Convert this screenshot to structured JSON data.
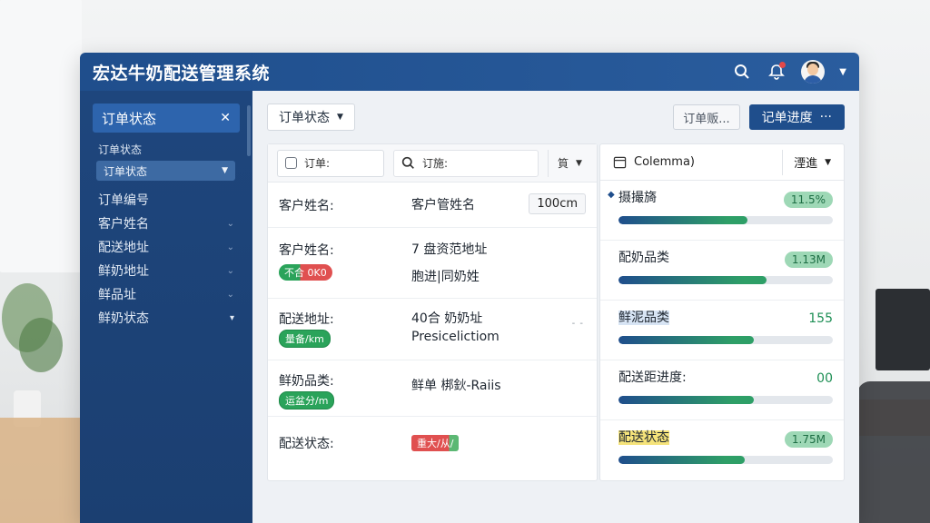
{
  "app": {
    "title": "宏达牛奶配送管理系统"
  },
  "sidebar": {
    "header_label": "订单状态",
    "sub_label": "订单状态",
    "select_value": "订单状态",
    "items": [
      {
        "label": "订单编号"
      },
      {
        "label": "客户姓名"
      },
      {
        "label": "配送地址"
      },
      {
        "label": "鲜奶地址"
      },
      {
        "label": "鲜品址"
      },
      {
        "label": "鲜奶状态"
      }
    ]
  },
  "toolbar": {
    "status_dropdown": "订单状态",
    "outline_button": "订单贩...",
    "primary_button": "记单进度",
    "primary_more": "···"
  },
  "filters": {
    "checkbox_label": "订单:",
    "search_label": "订施:",
    "dropdown_label": "筫"
  },
  "rows": [
    {
      "label": "客户姓名:",
      "value": "客户管姓名",
      "extra": "100cm"
    },
    {
      "label": "客户姓名:",
      "value": "7 盘资范地址",
      "value2": "胞进|同奶姓",
      "badge": "不合 0K0"
    },
    {
      "label": "配送地址:",
      "value": "40合 奶奶址",
      "value2": "Presicelictiom",
      "badge": "量备/km",
      "dots": "- -"
    },
    {
      "label": "鲜奶品类:",
      "value": "鲜单 梆鈥-Raiis",
      "badge": "运盆分/m"
    },
    {
      "label": "配送状态:",
      "badge": "重大/从/"
    }
  ],
  "metrics_panel": {
    "header": "Colemma)",
    "dropdown": "湮進",
    "items": [
      {
        "title": "摄撮旖",
        "value": "11.5%",
        "progress": 0.6,
        "pill": true
      },
      {
        "title": "配奶品类",
        "value": "1.13M",
        "progress": 0.69,
        "pill": true
      },
      {
        "title": "鲜泥品类",
        "value": "155",
        "progress": 0.63,
        "pill": false
      },
      {
        "title": "配送距进度:",
        "value": "00",
        "progress": 0.63,
        "pill": false
      },
      {
        "title": "配送状态",
        "value": "1.75M",
        "progress": 0.59,
        "pill": true
      }
    ]
  },
  "colors": {
    "brand": "#1f4e8c",
    "success": "#2aa35a",
    "danger": "#e05050"
  }
}
